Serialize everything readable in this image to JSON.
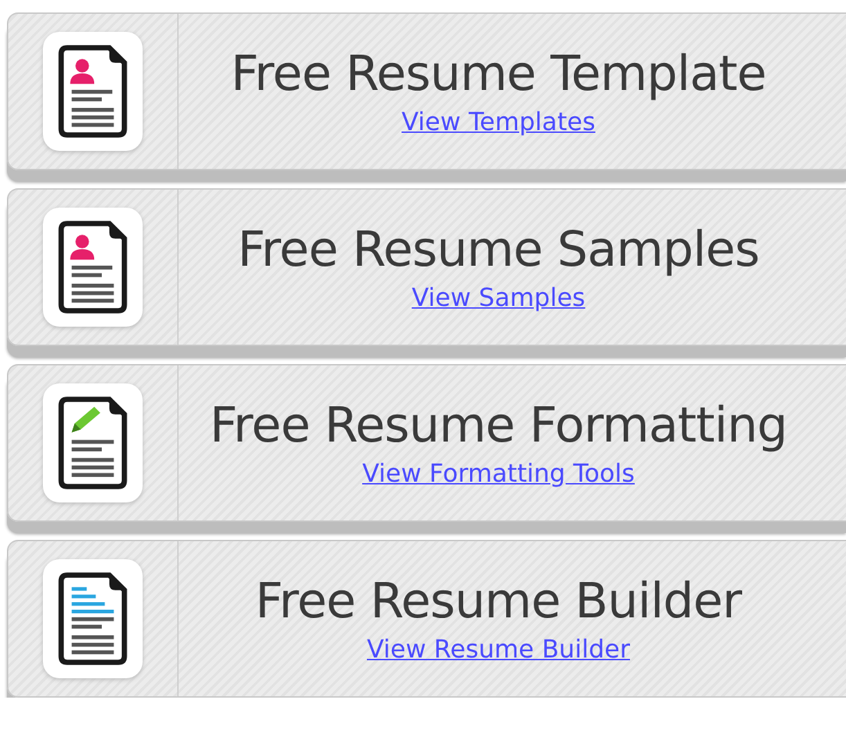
{
  "cards": [
    {
      "title": "Free Resume Template",
      "link": "View Templates",
      "icon": {
        "kind": "person"
      }
    },
    {
      "title": "Free Resume Samples",
      "link": "View Samples",
      "icon": {
        "kind": "person"
      }
    },
    {
      "title": "Free Resume Formatting",
      "link": "View Formatting Tools",
      "icon": {
        "kind": "pencil"
      }
    },
    {
      "title": "Free Resume Builder",
      "link": "View Resume Builder",
      "icon": {
        "kind": "lines"
      }
    }
  ]
}
